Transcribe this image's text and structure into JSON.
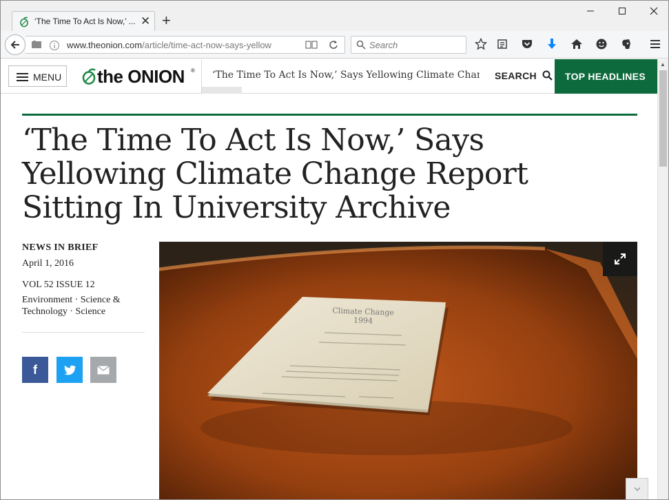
{
  "browser": {
    "tab_title": "‘The Time To Act Is Now,’ ...",
    "new_tab": "+",
    "tab_close": "✕",
    "url_host": "www.theonion.com",
    "url_path": "/article/time-act-now-says-yellow",
    "search_placeholder": "Search"
  },
  "site": {
    "menu_label": "MENU",
    "logo_text": "the ONION",
    "logo_reg": "®",
    "ticker_text": "‘The Time To Act Is Now,’ Says Yellowing Climate Change Report Sitting In University Archive",
    "search_label": "SEARCH",
    "top_headlines_label": "TOP HEADLINES"
  },
  "article": {
    "headline": "‘The Time To Act Is Now,’ Says Yellowing Climate Change Report Sitting In University Archive",
    "section": "NEWS IN BRIEF",
    "date": "April 1, 2016",
    "volume": "VOL 52 ISSUE 12",
    "tags": "Environment · Science & Technology · Science",
    "share": {
      "facebook": "f",
      "twitter_icon": "twitter-bird",
      "email_icon": "envelope"
    },
    "photo_doc_title": "Climate Change",
    "photo_doc_year": "1994"
  },
  "colors": {
    "brand_green": "#0d6a3c",
    "facebook": "#3b5998",
    "twitter": "#1da1f2",
    "email": "#a6a9ab",
    "download_arrow": "#0a84ff"
  }
}
